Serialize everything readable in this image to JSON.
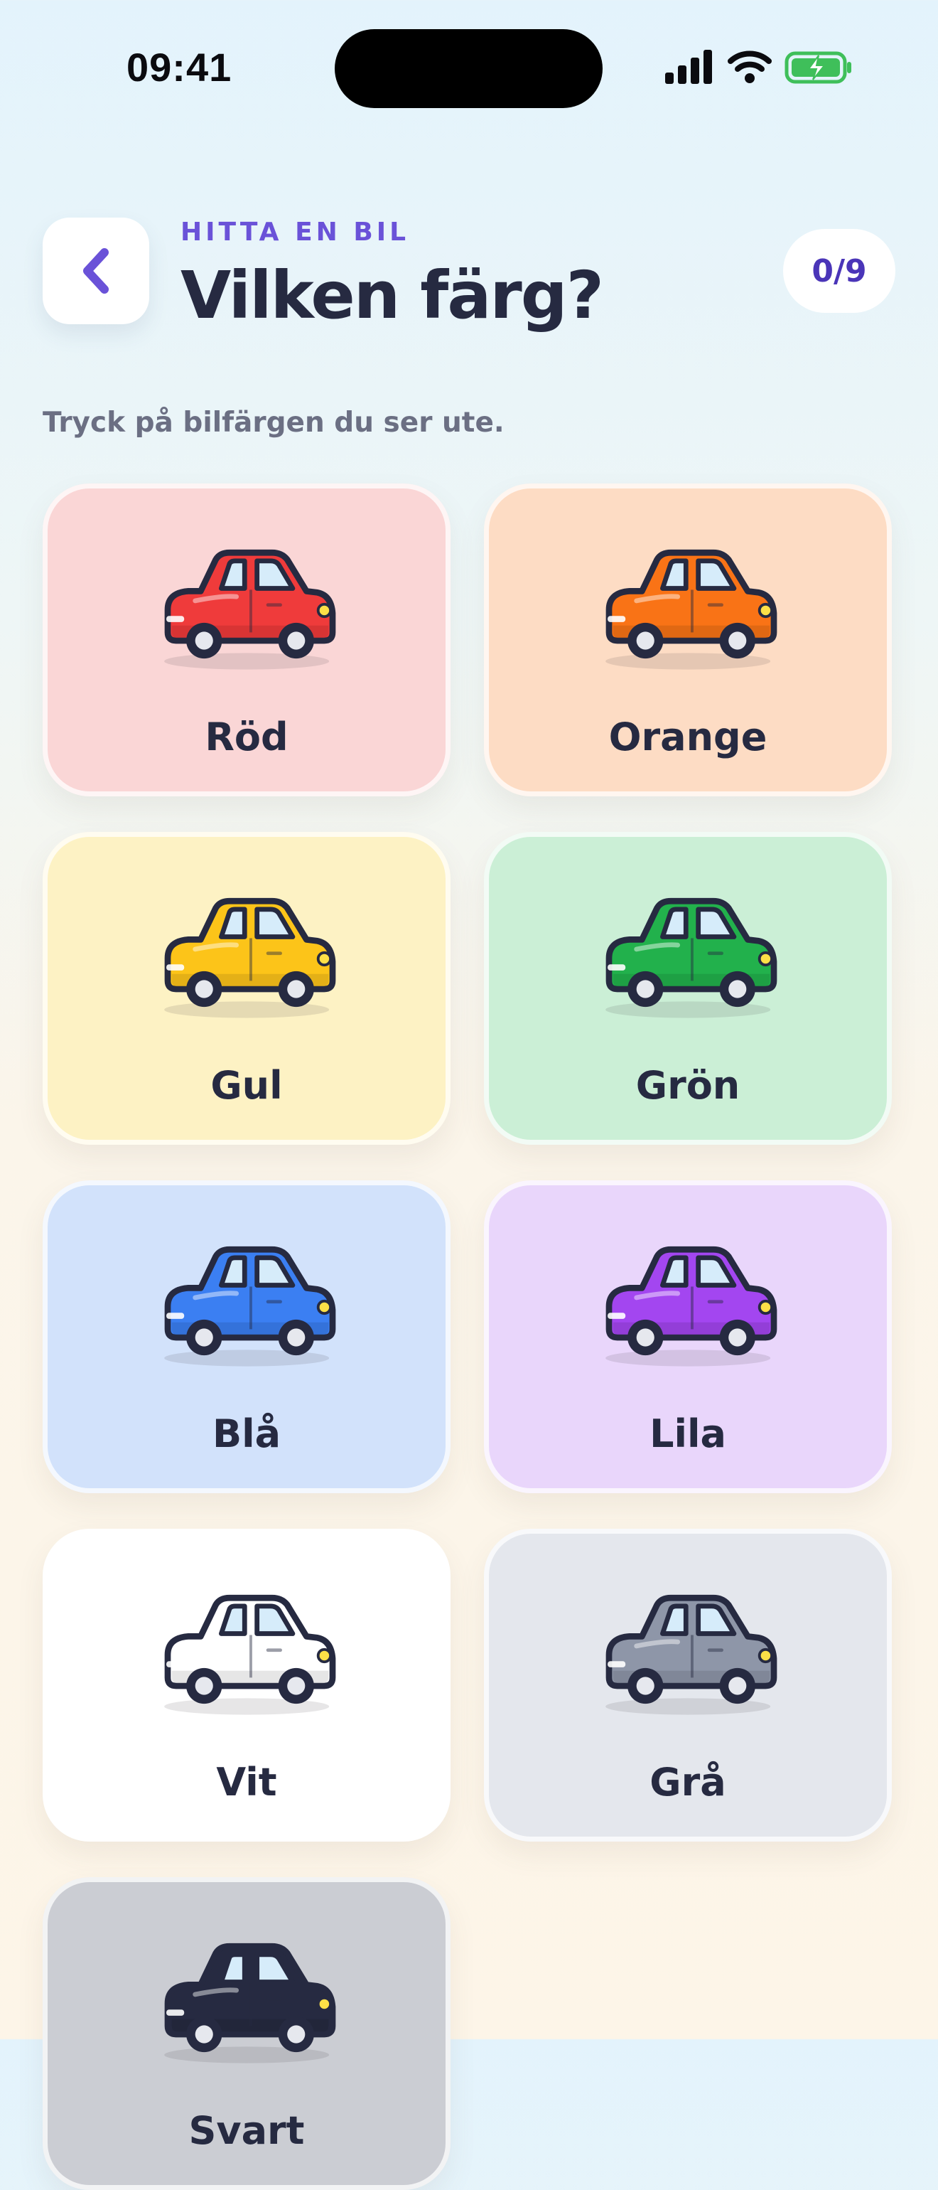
{
  "status": {
    "time": "09:41"
  },
  "header": {
    "eyebrow": "HITTA EN BIL",
    "title": "Vilken färg?",
    "counter": "0/9"
  },
  "hint": "Tryck på bilfärgen du ser ute.",
  "colors": [
    {
      "label": "Röd",
      "body": "#ef3b3b",
      "card": "#fad6d6"
    },
    {
      "label": "Orange",
      "body": "#f97316",
      "card": "#fddcc4"
    },
    {
      "label": "Gul",
      "body": "#fcc419",
      "card": "#fdf2c4"
    },
    {
      "label": "Grön",
      "body": "#22b14c",
      "card": "#cbefd6"
    },
    {
      "label": "Blå",
      "body": "#3b7ff2",
      "card": "#d2e2fb"
    },
    {
      "label": "Lila",
      "body": "#a346f0",
      "card": "#e9d6fb"
    },
    {
      "label": "Vit",
      "body": "#ffffff",
      "card": "#ffffff"
    },
    {
      "label": "Grå",
      "body": "#8e96a8",
      "card": "#e4e7ed"
    },
    {
      "label": "Svart",
      "body": "#262a41",
      "card": "#cbcdd3"
    }
  ]
}
